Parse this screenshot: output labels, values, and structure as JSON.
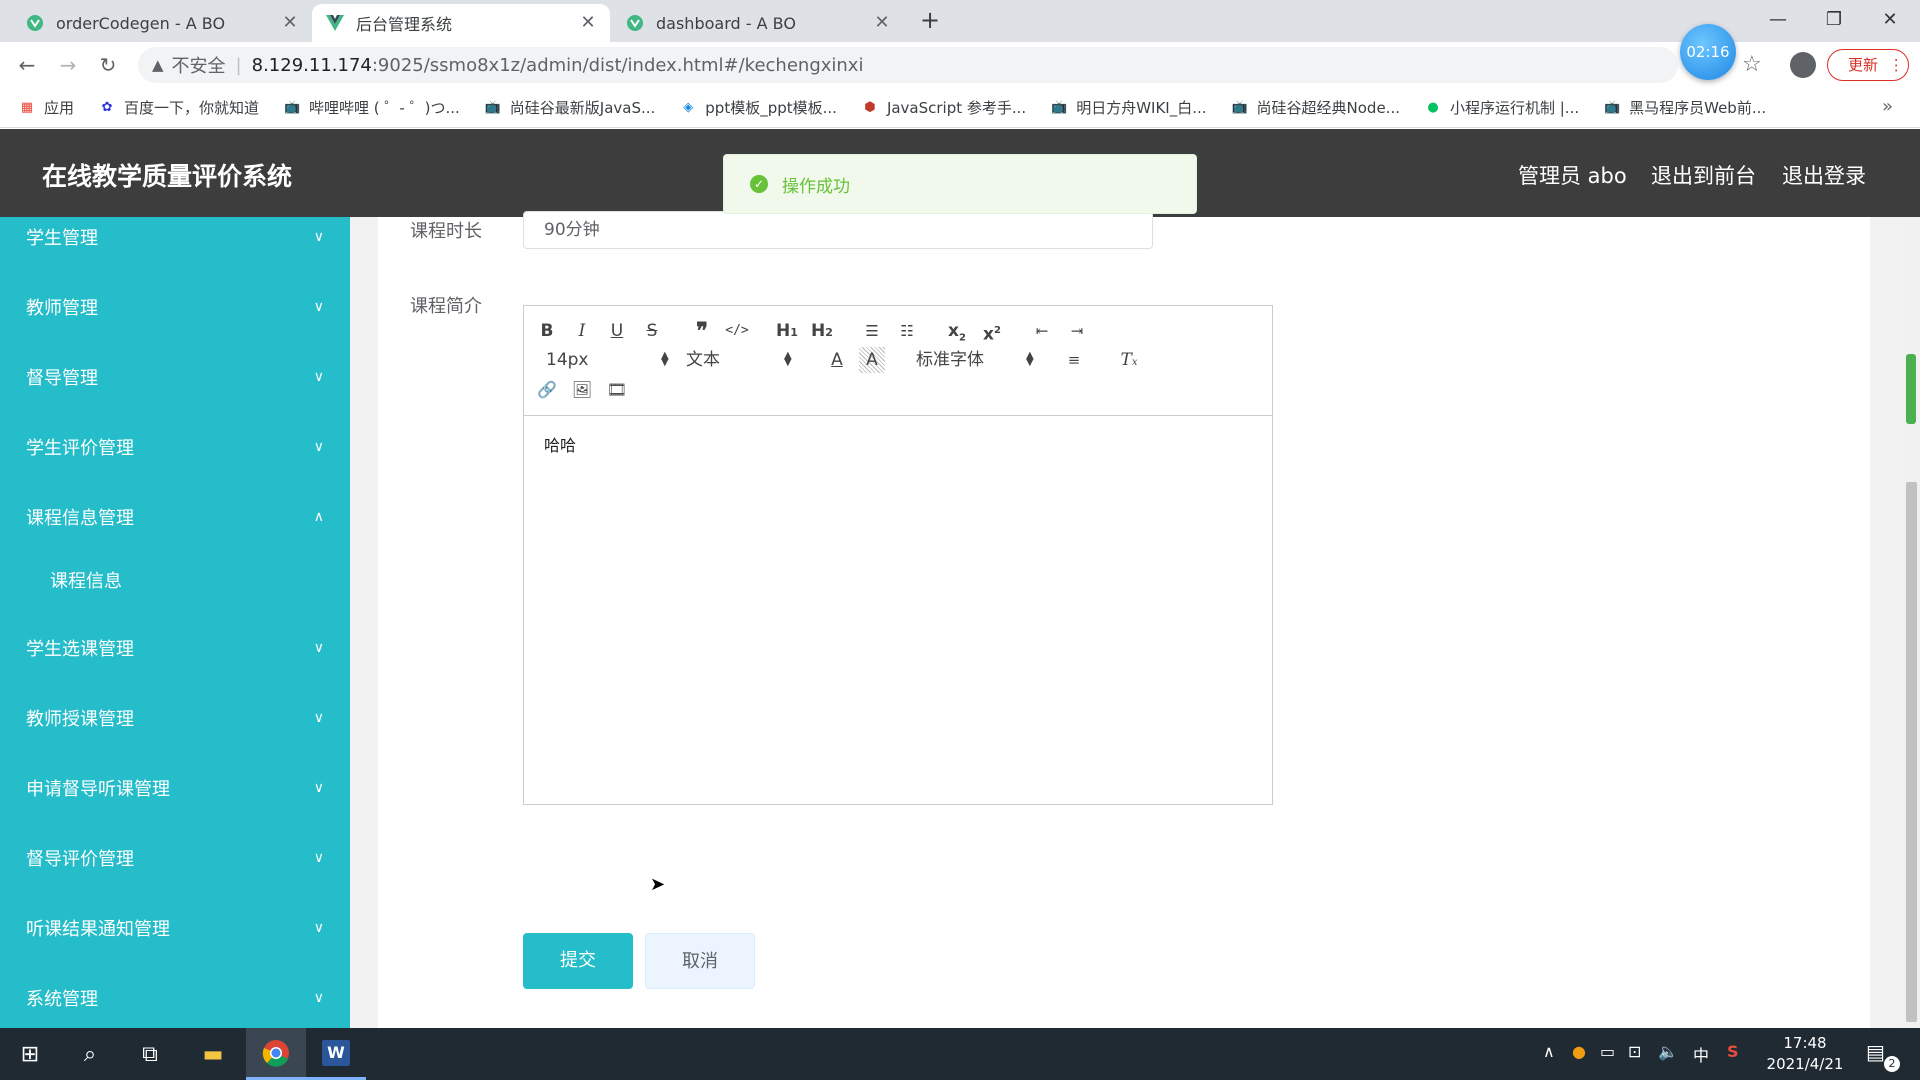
{
  "browser": {
    "tabs": [
      {
        "title": "orderCodegen - A BO"
      },
      {
        "title": "后台管理系统"
      },
      {
        "title": "dashboard - A BO"
      }
    ],
    "security_label": "不安全",
    "url_host": "8.129.11.174",
    "url_rest": ":9025/ssmo8x1z/admin/dist/index.html#/kechengxinxi",
    "timer": "02:16",
    "update_label": "更新",
    "bookmarks": [
      {
        "label": "应用",
        "icon": "apps-grid-icon",
        "color": "#e94235"
      },
      {
        "label": "百度一下，你就知道",
        "icon": "baidu-paw-icon",
        "color": "#2932e1"
      },
      {
        "label": "哔哩哔哩 ( ゜- ゜)つ...",
        "icon": "bilibili-icon",
        "color": "#00a1d6"
      },
      {
        "label": "尚硅谷最新版JavaS...",
        "icon": "bilibili-icon",
        "color": "#00a1d6"
      },
      {
        "label": "ppt模板_ppt模板...",
        "icon": "ppt-logo-icon",
        "color": "#1e88e5"
      },
      {
        "label": "JavaScript 参考手...",
        "icon": "runoob-icon",
        "color": "#c0392b"
      },
      {
        "label": "明日方舟WIKI_白...",
        "icon": "bilibili-icon",
        "color": "#00a1d6"
      },
      {
        "label": "尚硅谷超经典Node...",
        "icon": "bilibili-icon",
        "color": "#00a1d6"
      },
      {
        "label": "小程序运行机制 |...",
        "icon": "wechat-icon",
        "color": "#07c160"
      },
      {
        "label": "黑马程序员Web前...",
        "icon": "bilibili-icon",
        "color": "#00a1d6"
      }
    ]
  },
  "header": {
    "title": "在线教学质量评价系统",
    "user": "管理员 abo",
    "to_front": "退出到前台",
    "logout": "退出登录"
  },
  "toast": {
    "message": "操作成功"
  },
  "sidebar": {
    "items": [
      {
        "label": "学生管理"
      },
      {
        "label": "教师管理"
      },
      {
        "label": "督导管理"
      },
      {
        "label": "学生评价管理"
      },
      {
        "label": "课程信息管理"
      },
      {
        "label": "学生选课管理"
      },
      {
        "label": "教师授课管理"
      },
      {
        "label": "申请督导听课管理"
      },
      {
        "label": "督导评价管理"
      },
      {
        "label": "听课结果通知管理"
      },
      {
        "label": "系统管理"
      }
    ],
    "sub_item": "课程信息"
  },
  "form": {
    "duration_label": "课程时长",
    "duration_value": "90分钟",
    "intro_label": "课程简介",
    "editor": {
      "font_size": "14px",
      "text_style": "文本",
      "font_family": "标准字体",
      "content": "哈哈"
    },
    "submit": "提交",
    "cancel": "取消"
  },
  "taskbar": {
    "time": "17:48",
    "date": "2021/4/21",
    "ime": "中",
    "notifications": "2"
  },
  "colors": {
    "sidebar": "#24bdc9",
    "header": "#3d3d3d",
    "success": "#67c23a"
  }
}
